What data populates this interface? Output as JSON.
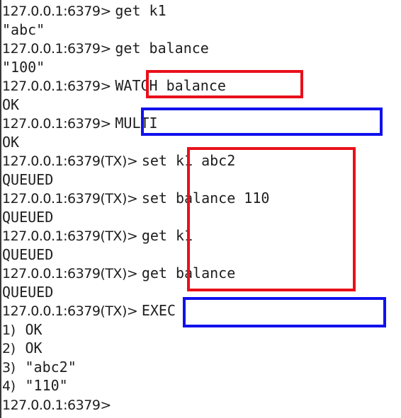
{
  "colors": {
    "red_box": "#e8101a",
    "blue_box": "#1111ee",
    "text": "#1e1e1e",
    "background": "#ffffff"
  },
  "lines": [
    {
      "prompt": "127.0.0.1:6379> ",
      "command": "get k1"
    },
    {
      "output": "\"abc\""
    },
    {
      "prompt": "127.0.0.1:6379> ",
      "command": "get balance"
    },
    {
      "output": "\"100\""
    },
    {
      "prompt": "127.0.0.1:6379> ",
      "command": "WATCH balance"
    },
    {
      "output": "OK"
    },
    {
      "prompt": "127.0.0.1:6379> ",
      "command": "MULTI"
    },
    {
      "output": "OK"
    },
    {
      "prompt": "127.0.0.1:6379(TX)> ",
      "command": "set k1 abc2"
    },
    {
      "output": "QUEUED"
    },
    {
      "prompt": "127.0.0.1:6379(TX)> ",
      "command": "set balance 110"
    },
    {
      "output": "QUEUED"
    },
    {
      "prompt": "127.0.0.1:6379(TX)> ",
      "command": "get k1"
    },
    {
      "output": "QUEUED"
    },
    {
      "prompt": "127.0.0.1:6379(TX)> ",
      "command": "get balance"
    },
    {
      "output": "QUEUED"
    },
    {
      "prompt": "127.0.0.1:6379(TX)> ",
      "command": "EXEC"
    },
    {
      "index": "1)",
      "output": "OK"
    },
    {
      "index": "2)",
      "output": "OK"
    },
    {
      "index": "3)",
      "output": "\"abc2\""
    },
    {
      "index": "4)",
      "output": "\"110\""
    },
    {
      "prompt": "127.0.0.1:6379> ",
      "command": ""
    }
  ]
}
